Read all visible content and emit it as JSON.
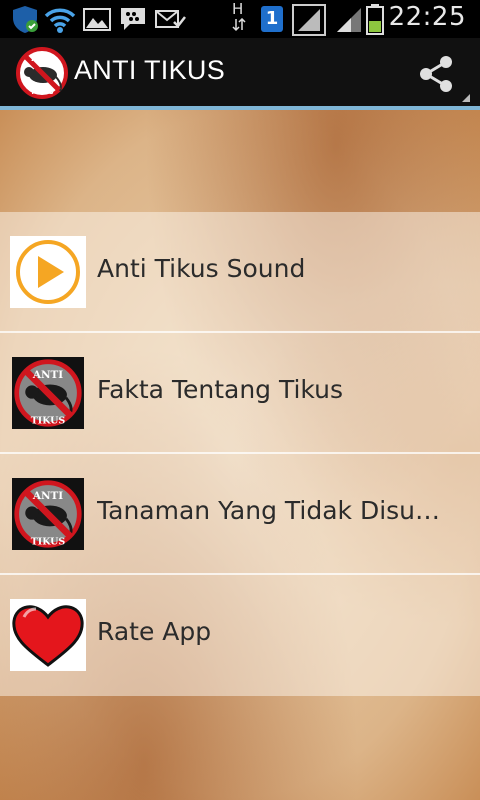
{
  "status_bar": {
    "time": "22:25",
    "network_type": "H",
    "notification_count": "1"
  },
  "action_bar": {
    "title": "ANTI TIKUS",
    "logo_text_top": "ANTI",
    "logo_text_bottom": "TIKUS"
  },
  "menu": {
    "items": [
      {
        "label": "Anti Tikus Sound",
        "icon": "play-icon"
      },
      {
        "label": "Fakta Tentang Tikus",
        "icon": "anti-rat-icon"
      },
      {
        "label": "Tanaman Yang Tidak Disu…",
        "icon": "anti-rat-icon"
      },
      {
        "label": "Rate App",
        "icon": "heart-icon"
      }
    ]
  },
  "colors": {
    "accent_underline": "#7fb6d6",
    "play_orange": "#f5a623",
    "prohibition_red": "#d0161e",
    "heart_red": "#e4161c"
  }
}
